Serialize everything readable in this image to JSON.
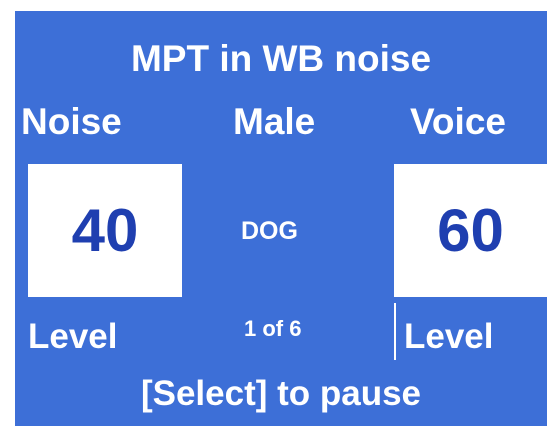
{
  "title": "MPT in WB noise",
  "noise": {
    "header": "Noise",
    "level_value": "40",
    "footer": "Level"
  },
  "talker": {
    "header": "Male",
    "word": "DOG",
    "progress": "1 of 6"
  },
  "voice": {
    "header": "Voice",
    "level_value": "60",
    "footer": "Level"
  },
  "instruction": "[Select] to pause",
  "colors": {
    "background": "#3d6fd7",
    "text": "#ffffff",
    "box": "#ffffff",
    "number": "#1f3fb0"
  }
}
